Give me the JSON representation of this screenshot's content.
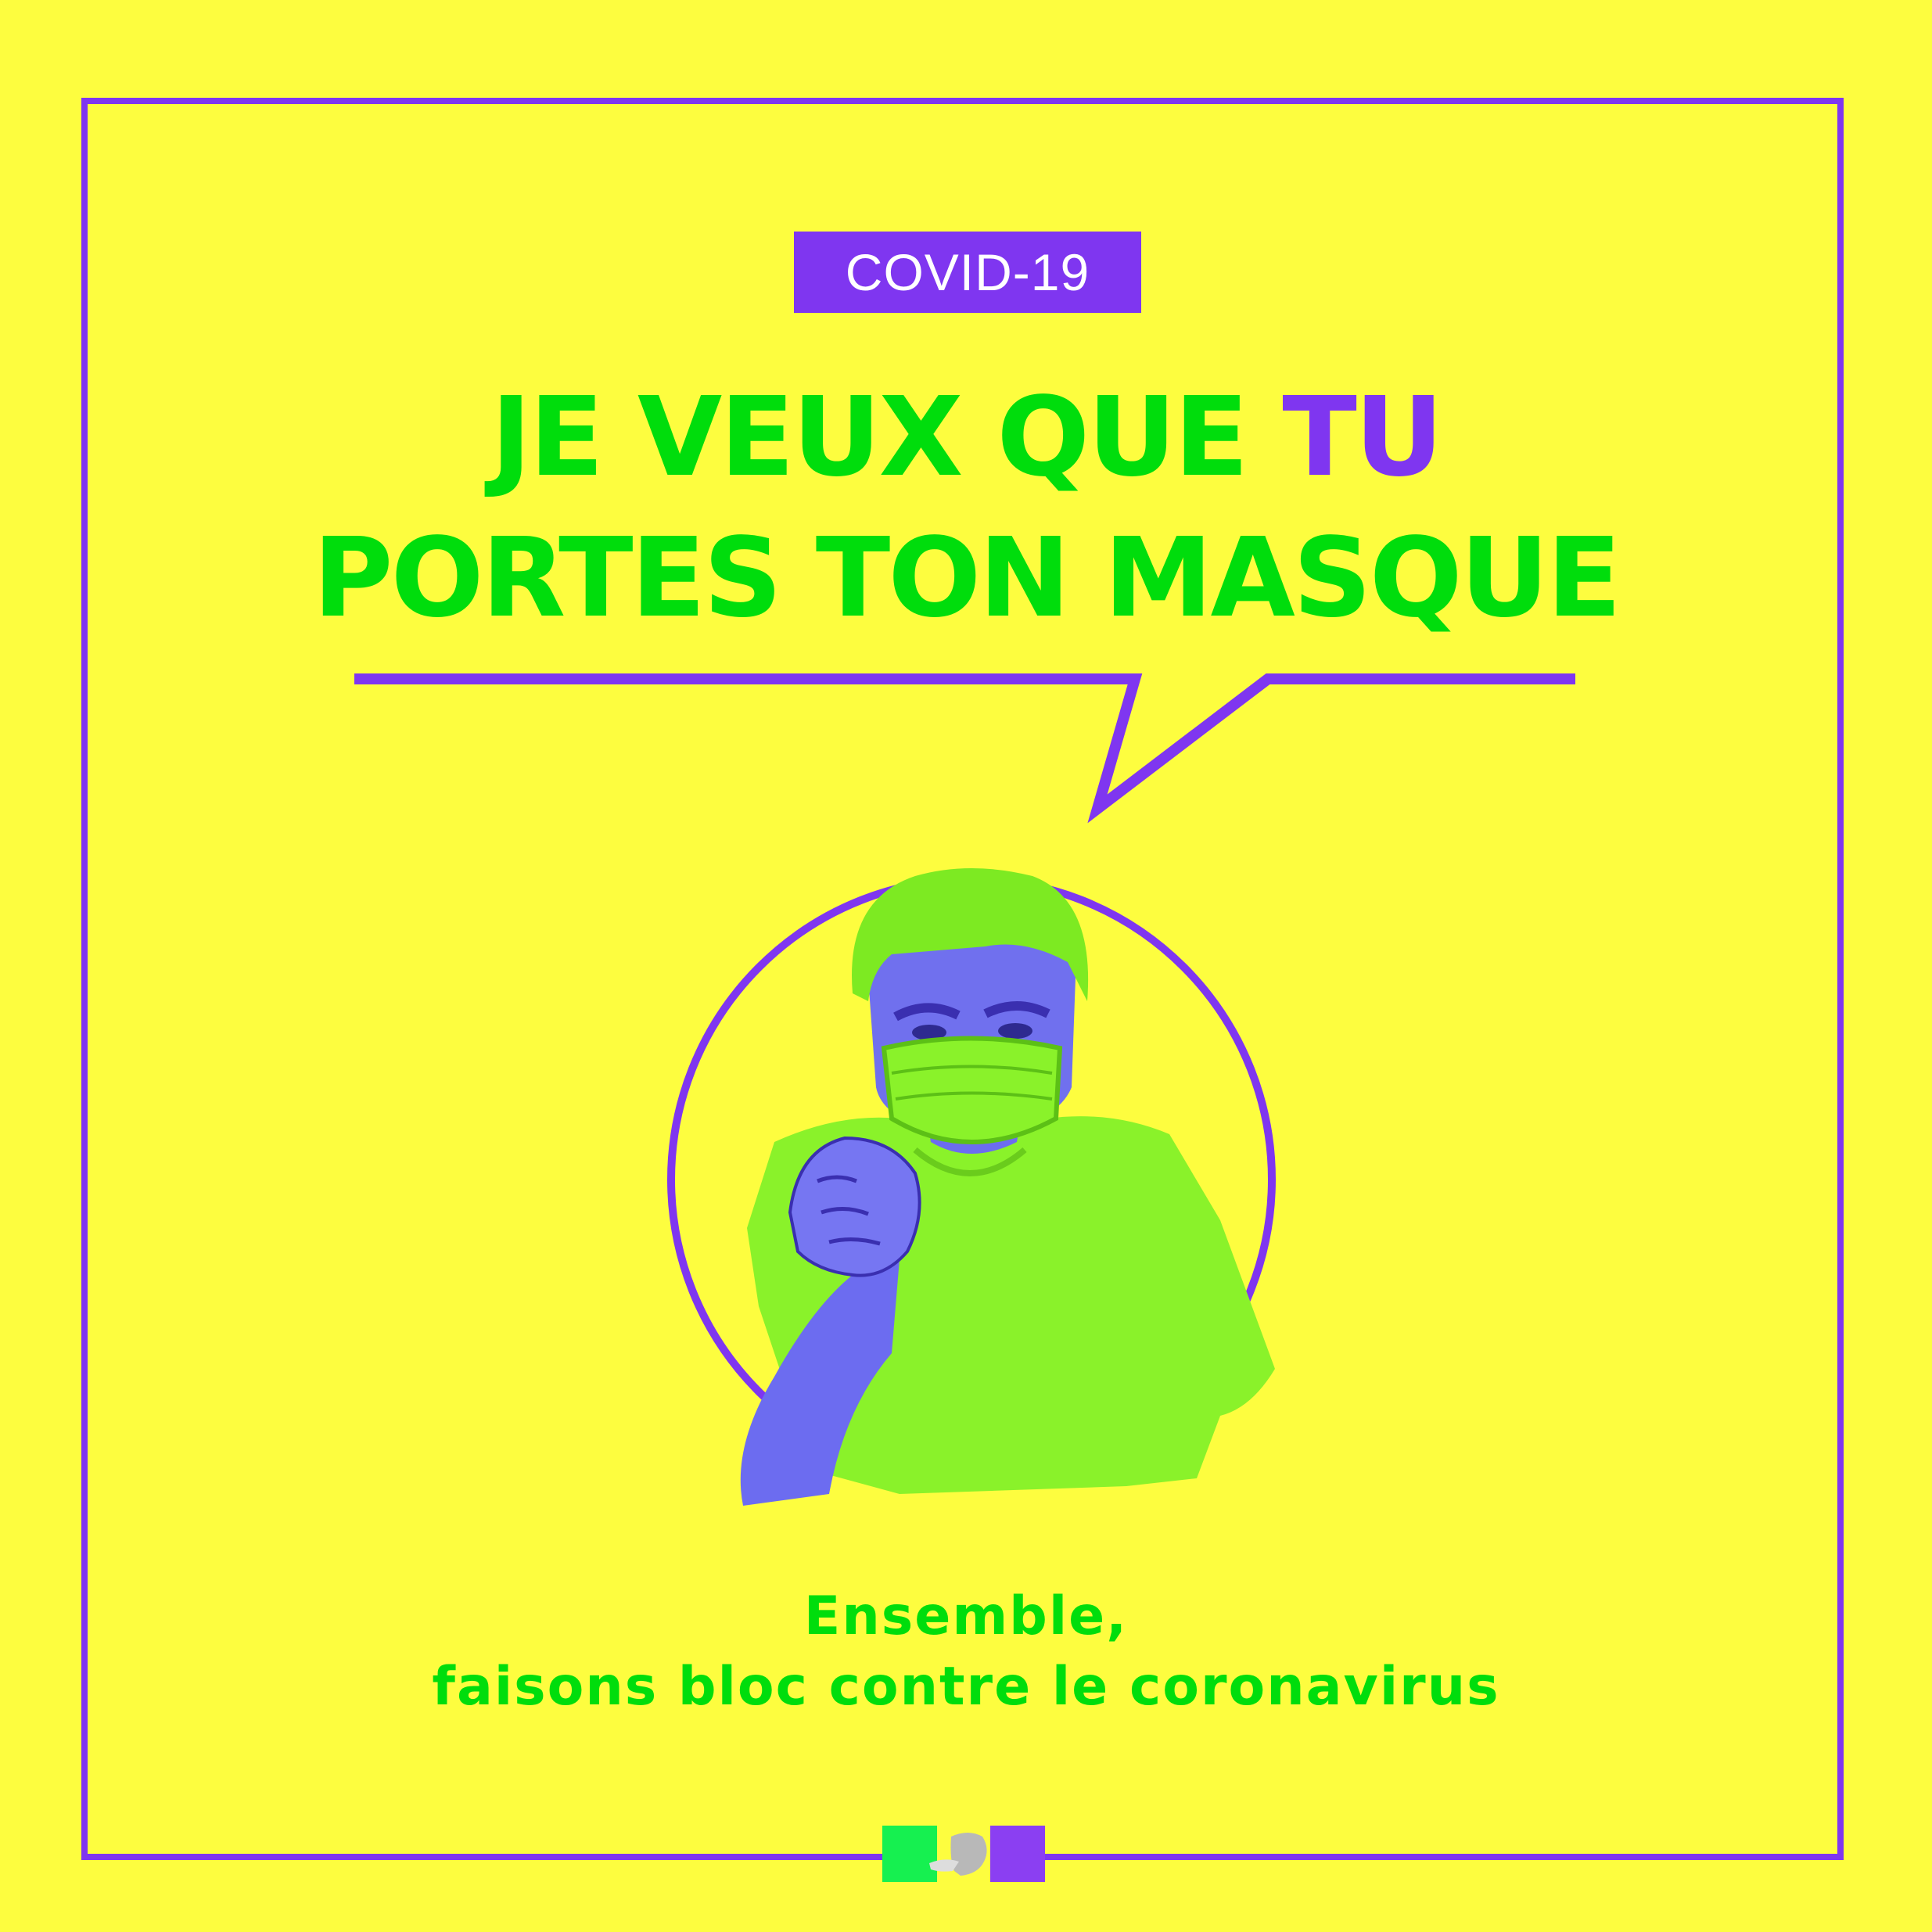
{
  "poster": {
    "tag": "COVID-19",
    "headline_line1_part1": "JE VEUX QUE ",
    "headline_line1_accent": "TU",
    "headline_line2": "PORTES TON MASQUE",
    "tagline_line1": "Ensemble,",
    "tagline_line2": "faisons bloc contre le coronavirus"
  },
  "illustration": {
    "subject": "masked man pointing at viewer"
  },
  "colors": {
    "background": "#FDFD3F",
    "purple": "#7F36F0",
    "green": "#00DD0C",
    "figure_green": "#8AF22A",
    "skin_purple": "#6C6CF0"
  },
  "icons": [
    "speech-bubble-icon",
    "marianne-logo-icon"
  ]
}
